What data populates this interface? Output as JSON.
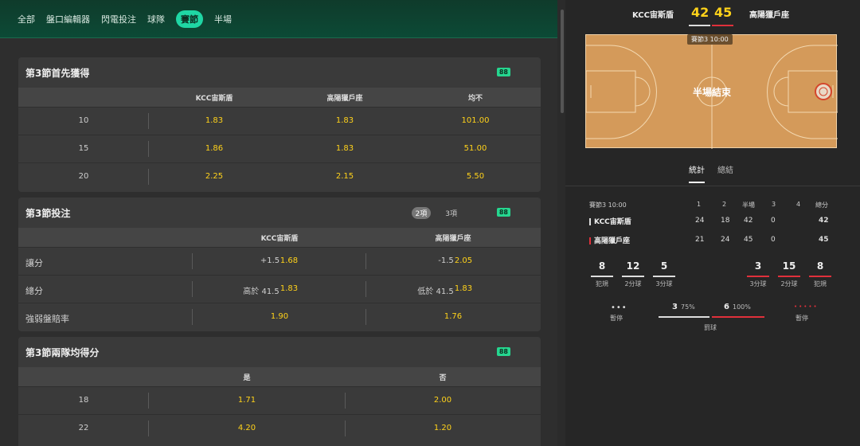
{
  "nav": {
    "items": [
      {
        "label": "全部",
        "active": false
      },
      {
        "label": "盤口編輯器",
        "active": false
      },
      {
        "label": "閃電投注",
        "active": false
      },
      {
        "label": "球隊",
        "active": false
      },
      {
        "label": "賽節",
        "active": true
      },
      {
        "label": "半場",
        "active": false
      }
    ]
  },
  "cards": {
    "first_score": {
      "title": "第3節首先獲得",
      "badge": "88",
      "headers": [
        "KCC宙斯盾",
        "高陽獵戶座",
        "均不"
      ],
      "rows": [
        {
          "label": "10",
          "odds": [
            "1.83",
            "1.83",
            "101.00"
          ]
        },
        {
          "label": "15",
          "odds": [
            "1.86",
            "1.83",
            "51.00"
          ]
        },
        {
          "label": "20",
          "odds": [
            "2.25",
            "2.15",
            "5.50"
          ]
        }
      ]
    },
    "bets": {
      "title": "第3節投注",
      "badge": "88",
      "subtabs": [
        "2項",
        "3項"
      ],
      "headers": [
        "KCC宙斯盾",
        "高陽獵戶座"
      ],
      "rows": [
        {
          "label": "讓分",
          "a_line": "+1.5",
          "a_odd": "1.68",
          "b_line": "-1.5",
          "b_odd": "2.05"
        },
        {
          "label": "總分",
          "a_line": "高於 41.5",
          "a_odd": "1.83",
          "b_line": "低於 41.5",
          "b_odd": "1.83"
        },
        {
          "label": "強弱盤賠率",
          "a_line": "",
          "a_odd": "1.90",
          "b_line": "",
          "b_odd": "1.76"
        }
      ]
    },
    "both_score": {
      "title": "第3節兩隊均得分",
      "badge": "88",
      "headers": [
        "是",
        "否"
      ],
      "rows": [
        {
          "label": "18",
          "odds": [
            "1.71",
            "2.00"
          ]
        },
        {
          "label": "22",
          "odds": [
            "4.20",
            "1.20"
          ]
        }
      ]
    }
  },
  "score": {
    "team_a": "KCC宙斯盾",
    "team_b": "高陽獵戶座",
    "score_a": "42",
    "score_b": "45",
    "court_badge": "賽節3   10:00",
    "court_status": "半場結束"
  },
  "stats_tabs": [
    "統計",
    "總結"
  ],
  "stats": {
    "period_label": "賽節3  10:00",
    "cols": [
      "1",
      "2",
      "半場",
      "3",
      "4",
      "總分"
    ],
    "rows": [
      {
        "team": "KCC宙斯盾",
        "vals": [
          "24",
          "18",
          "42",
          "0",
          "",
          "42"
        ]
      },
      {
        "team": "高陽獵戶座",
        "vals": [
          "21",
          "24",
          "45",
          "0",
          "",
          "45"
        ]
      }
    ]
  },
  "mini_stats": {
    "a": [
      {
        "n": "8",
        "l": "犯規"
      },
      {
        "n": "12",
        "l": "2分球"
      },
      {
        "n": "5",
        "l": "3分球"
      }
    ],
    "b": [
      {
        "n": "3",
        "l": "3分球"
      },
      {
        "n": "15",
        "l": "2分球"
      },
      {
        "n": "8",
        "l": "犯規"
      }
    ],
    "timeout_label": "暫停",
    "ft_label": "罰球",
    "ft_a": "3",
    "ft_a_pct": "75%",
    "ft_b": "6",
    "ft_b_pct": "100%"
  },
  "colors": {
    "accent": "#1fd6a4",
    "odds": "#ffd21a",
    "team_b": "#e0303b"
  }
}
